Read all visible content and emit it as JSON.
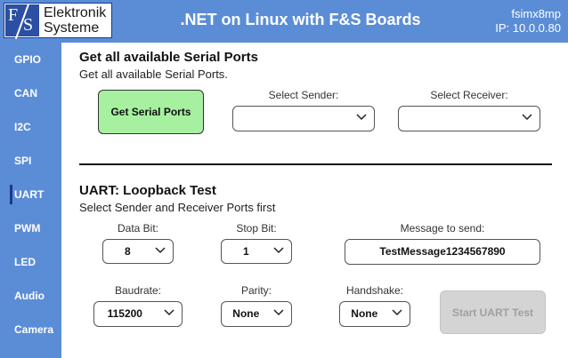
{
  "header": {
    "logo_line1": "Elektronik",
    "logo_line2": "Systeme",
    "logo_mark_f": "F",
    "logo_mark_s": "S",
    "title": ".NET on Linux with F&S Boards",
    "hostname": "fsimx8mp",
    "ip": "IP: 10.0.0.80"
  },
  "sidebar": {
    "items": [
      {
        "label": "GPIO",
        "active": false
      },
      {
        "label": "CAN",
        "active": false
      },
      {
        "label": "I2C",
        "active": false
      },
      {
        "label": "SPI",
        "active": false
      },
      {
        "label": "UART",
        "active": true
      },
      {
        "label": "PWM",
        "active": false
      },
      {
        "label": "LED",
        "active": false
      },
      {
        "label": "Audio",
        "active": false
      },
      {
        "label": "Camera",
        "active": false
      }
    ]
  },
  "serial_section": {
    "title": "Get all available Serial Ports",
    "subtitle": "Get all available Serial Ports.",
    "button_label": "Get Serial Ports",
    "sender_label": "Select Sender:",
    "sender_value": "",
    "receiver_label": "Select Receiver:",
    "receiver_value": ""
  },
  "loopback_section": {
    "title": "UART: Loopback Test",
    "subtitle": "Select Sender and Receiver Ports first",
    "data_bit_label": "Data Bit:",
    "data_bit_value": "8",
    "stop_bit_label": "Stop Bit:",
    "stop_bit_value": "1",
    "message_label": "Message to send:",
    "message_value": "TestMessage1234567890",
    "baudrate_label": "Baudrate:",
    "baudrate_value": "115200",
    "parity_label": "Parity:",
    "parity_value": "None",
    "handshake_label": "Handshake:",
    "handshake_value": "None",
    "start_button_label": "Start UART Test"
  },
  "colors": {
    "accent": "#5b8dd6",
    "button_green": "#a6f0a0",
    "disabled_button": "#d4d4d4"
  }
}
